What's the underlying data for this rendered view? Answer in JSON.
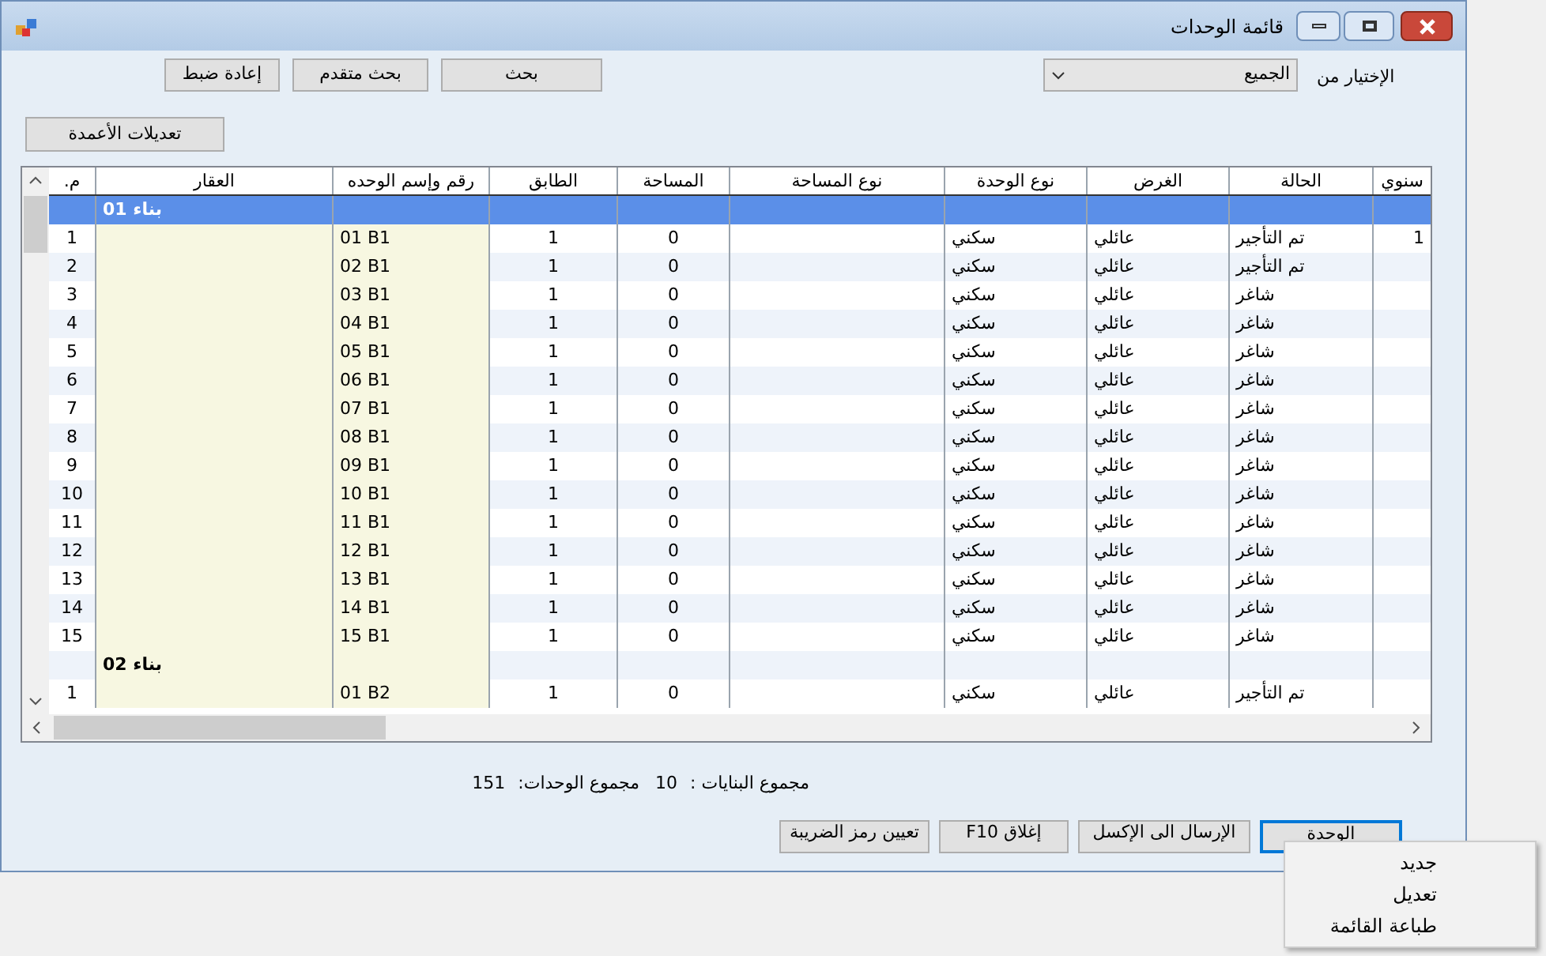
{
  "window": {
    "title": "قائمة الوحدات"
  },
  "filter": {
    "label": "الإختيار من",
    "value": "الجميع"
  },
  "search_buttons": [
    "بحث",
    "بحث متقدم",
    "إعادة ضبط"
  ],
  "columns_button": "تعديلات الأعمدة",
  "table": {
    "columns": [
      "سنوي",
      "الحالة",
      "الغرض",
      "نوع الوحدة",
      "نوع المساحة",
      "المساحة",
      "الطابق",
      "رقم وإسم الوحده",
      "العقار",
      "م."
    ],
    "groups": [
      {
        "label": "بناء 01",
        "selected": true,
        "rows": [
          {
            "number": "1",
            "unit": "01 B1",
            "floor": "1",
            "area": "0",
            "unit_type": "سكني",
            "purpose": "عائلي",
            "status": "تم التأجير",
            "column_10": "1"
          },
          {
            "number": "2",
            "unit": "02 B1",
            "floor": "1",
            "area": "0",
            "unit_type": "سكني",
            "purpose": "عائلي",
            "status": "تم التأجير"
          },
          {
            "number": "3",
            "unit": "03 B1",
            "floor": "1",
            "area": "0",
            "unit_type": "سكني",
            "purpose": "عائلي",
            "status": "شاغر"
          },
          {
            "number": "4",
            "unit": "04 B1",
            "floor": "1",
            "area": "0",
            "unit_type": "سكني",
            "purpose": "عائلي",
            "status": "شاغر"
          },
          {
            "number": "5",
            "unit": "05 B1",
            "floor": "1",
            "area": "0",
            "unit_type": "سكني",
            "purpose": "عائلي",
            "status": "شاغر"
          },
          {
            "number": "6",
            "unit": "06 B1",
            "floor": "1",
            "area": "0",
            "unit_type": "سكني",
            "purpose": "عائلي",
            "status": "شاغر"
          },
          {
            "number": "7",
            "unit": "07 B1",
            "floor": "1",
            "area": "0",
            "unit_type": "سكني",
            "purpose": "عائلي",
            "status": "شاغر"
          },
          {
            "number": "8",
            "unit": "08 B1",
            "floor": "1",
            "area": "0",
            "unit_type": "سكني",
            "purpose": "عائلي",
            "status": "شاغر"
          },
          {
            "number": "9",
            "unit": "09 B1",
            "floor": "1",
            "area": "0",
            "unit_type": "سكني",
            "purpose": "عائلي",
            "status": "شاغر"
          },
          {
            "number": "10",
            "unit": "10 B1",
            "floor": "1",
            "area": "0",
            "unit_type": "سكني",
            "purpose": "عائلي",
            "status": "شاغر"
          },
          {
            "number": "11",
            "unit": "11 B1",
            "floor": "1",
            "area": "0",
            "unit_type": "سكني",
            "purpose": "عائلي",
            "status": "شاغر"
          },
          {
            "number": "12",
            "unit": "12 B1",
            "floor": "1",
            "area": "0",
            "unit_type": "سكني",
            "purpose": "عائلي",
            "status": "شاغر"
          },
          {
            "number": "13",
            "unit": "13 B1",
            "floor": "1",
            "area": "0",
            "unit_type": "سكني",
            "purpose": "عائلي",
            "status": "شاغر"
          },
          {
            "number": "14",
            "unit": "14 B1",
            "floor": "1",
            "area": "0",
            "unit_type": "سكني",
            "purpose": "عائلي",
            "status": "شاغر"
          },
          {
            "number": "15",
            "unit": "15 B1",
            "floor": "1",
            "area": "0",
            "unit_type": "سكني",
            "purpose": "عائلي",
            "status": "شاغر"
          }
        ]
      },
      {
        "label": "بناء 02",
        "selected": false,
        "rows": [
          {
            "number": "1",
            "unit": "01 B2",
            "floor": "1",
            "area": "0",
            "unit_type": "سكني",
            "purpose": "عائلي",
            "status": "تم التأجير"
          }
        ]
      }
    ]
  },
  "totals": [
    {
      "label": "مجموع البنايات :",
      "value": "10"
    },
    {
      "label": "مجموع الوحدات:",
      "value": "151"
    }
  ],
  "buttons": [
    {
      "label": "الوحدة",
      "focused": true
    },
    {
      "label": "الإرسال الى الإكسل",
      "focused": false
    },
    {
      "label": "إغلاق F10",
      "focused": false
    },
    {
      "label": "تعيين رمز الضريبة",
      "focused": false
    }
  ],
  "menu": {
    "items": [
      "جديد",
      "تعديل",
      "طباعة القائمة"
    ]
  }
}
